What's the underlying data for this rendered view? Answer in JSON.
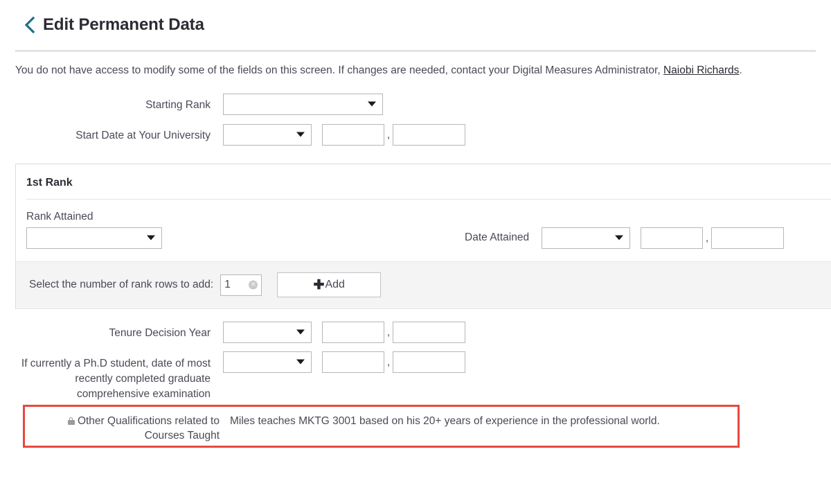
{
  "header": {
    "back_icon": "chevron-left-icon",
    "title": "Edit Permanent Data"
  },
  "notice": {
    "text_before": "You do not have access to modify some of the fields on this screen. If changes are needed, contact your Digital Measures Administrator, ",
    "link_text": "Naiobi Richards",
    "text_after": "."
  },
  "top_fields": [
    {
      "label": "Starting Rank",
      "type": "select",
      "value": ""
    },
    {
      "label": "Start Date at Your University",
      "type": "date",
      "value": ""
    }
  ],
  "rank_card": {
    "title": "1st Rank",
    "rank_attained": {
      "label": "Rank Attained",
      "value": ""
    },
    "date_attained": {
      "label": "Date Attained",
      "value": ""
    }
  },
  "add_rows": {
    "label": "Select the number of rank rows to add:",
    "count_value": "1",
    "clear_icon": "clear-circle-icon",
    "add_icon": "plus-icon",
    "add_label": "Add"
  },
  "lower_fields": [
    {
      "label": "Tenure Decision Year",
      "type": "date",
      "value": ""
    },
    {
      "label": "If currently a Ph.D student, date of most recently completed graduate comprehensive examination",
      "type": "date",
      "value": ""
    }
  ],
  "highlighted_field": {
    "lock_icon": "lock-icon",
    "label": "Other Qualifications related to Courses Taught",
    "value": "Miles teaches MKTG 3001 based on his 20+ years of experience in the professional world.",
    "highlight_color": "#e8483f"
  },
  "colors": {
    "accent": "#1f6f8b",
    "text": "#4a4a56",
    "heading": "#2b2b33",
    "band": "#f4f4f4",
    "border": "#b6b6b6"
  }
}
